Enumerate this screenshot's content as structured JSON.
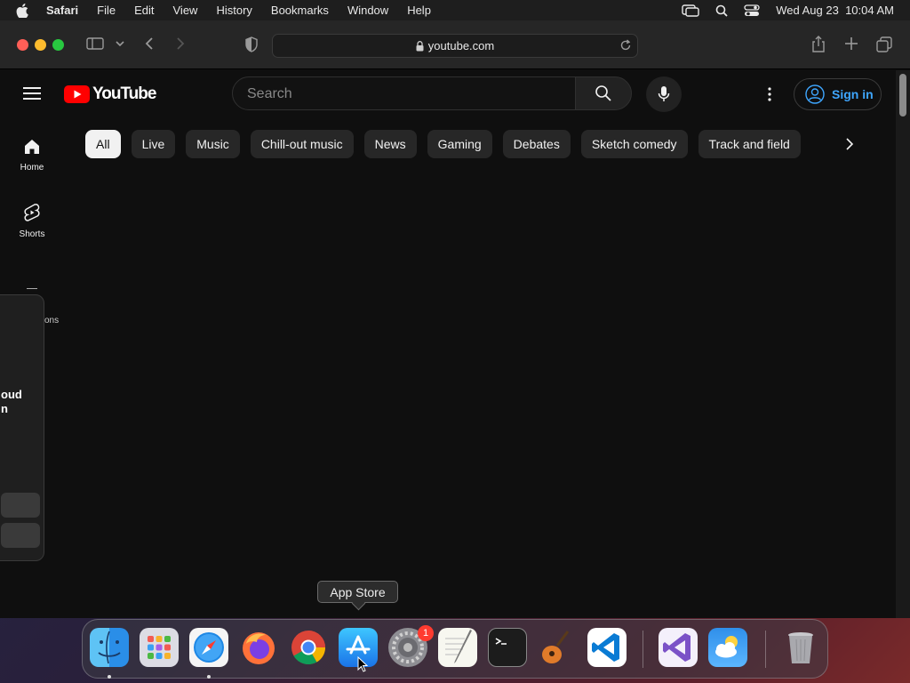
{
  "menubar": {
    "app_name": "Safari",
    "items": [
      "File",
      "Edit",
      "View",
      "History",
      "Bookmarks",
      "Window",
      "Help"
    ],
    "datetime": "Wed Aug 23  10:04 AM"
  },
  "browser": {
    "url": "youtube.com"
  },
  "youtube": {
    "logo_text": "YouTube",
    "search_placeholder": "Search",
    "signin_label": "Sign in",
    "guide": [
      {
        "label": "Home",
        "icon": "home-icon"
      },
      {
        "label": "Shorts",
        "icon": "shorts-icon"
      }
    ],
    "partial_guide_label": "ons",
    "chips": [
      "All",
      "Live",
      "Music",
      "Chill-out music",
      "News",
      "Gaming",
      "Debates",
      "Sketch comedy",
      "Track and field"
    ],
    "popover_text_line1": "oud",
    "popover_text_line2": "n"
  },
  "dock": {
    "tooltip": "App Store",
    "apps": [
      {
        "name": "Finder",
        "icon": "finder-icon"
      },
      {
        "name": "Launchpad",
        "icon": "launchpad-icon"
      },
      {
        "name": "Safari",
        "icon": "safari-icon"
      },
      {
        "name": "Firefox",
        "icon": "firefox-icon"
      },
      {
        "name": "Chrome",
        "icon": "chrome-icon"
      },
      {
        "name": "App Store",
        "icon": "app-store-icon"
      },
      {
        "name": "System Settings",
        "icon": "system-settings-icon"
      },
      {
        "name": "TextEdit",
        "icon": "textedit-icon"
      },
      {
        "name": "Terminal",
        "icon": "terminal-icon"
      },
      {
        "name": "GarageBand",
        "icon": "garageband-icon"
      },
      {
        "name": "Visual Studio Code",
        "icon": "vscode-icon"
      },
      {
        "name": "Visual Studio",
        "icon": "visual-studio-icon"
      },
      {
        "name": "Weather",
        "icon": "weather-icon"
      },
      {
        "name": "Trash",
        "icon": "trash-icon"
      }
    ],
    "settings_badge": "1"
  },
  "colors": {
    "youtube_red": "#ff0000",
    "signin_blue": "#3ea6ff",
    "background": "#0f0f0f"
  }
}
